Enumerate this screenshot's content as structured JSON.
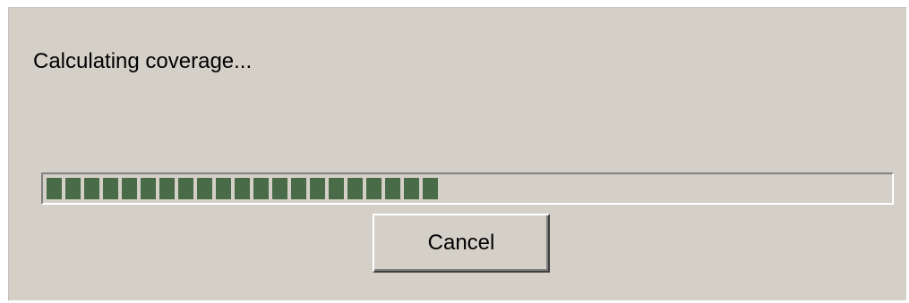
{
  "dialog": {
    "status_text": "Calculating coverage...",
    "progress": {
      "fraction": 0.46,
      "fill_color": "#4a6b48"
    },
    "cancel_label": "Cancel"
  }
}
